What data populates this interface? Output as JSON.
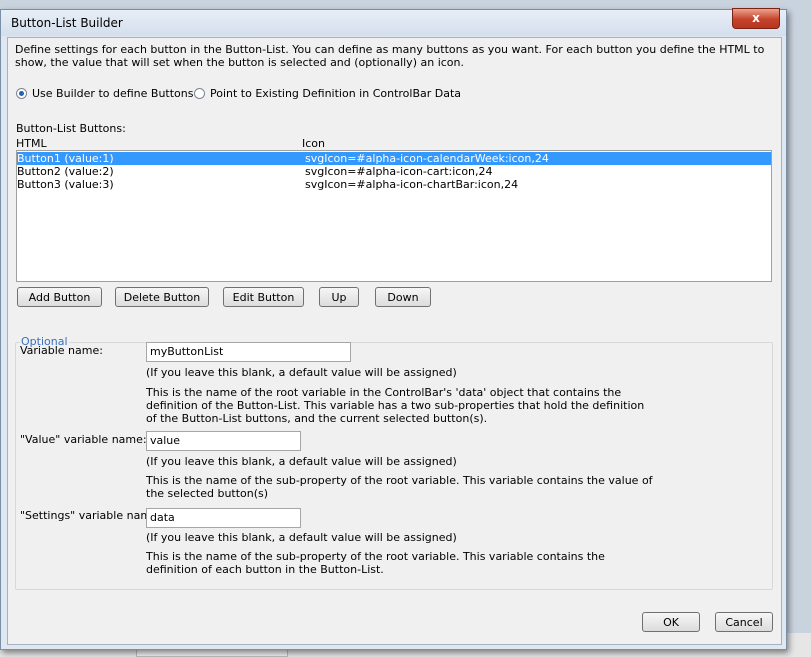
{
  "dialog": {
    "title": "Button-List Builder",
    "close_glyph": "x",
    "description": "Define settings for each button in the Button-List. You can define as many buttons as you want. For each button you define the HTML to show, the value that will set when the button is selected and (optionally) an icon."
  },
  "mode": {
    "option_builder": "Use Builder to define Buttons",
    "option_existing": "Point to Existing Definition in ControlBar Data",
    "selected": "builder"
  },
  "buttons_list": {
    "label": "Button-List Buttons:",
    "col_html": "HTML",
    "col_icon": "Icon",
    "rows": [
      {
        "html": "Button1 (value:1)",
        "icon": "svgIcon=#alpha-icon-calendarWeek:icon,24",
        "selected": true
      },
      {
        "html": "Button2 (value:2)",
        "icon": "svgIcon=#alpha-icon-cart:icon,24",
        "selected": false
      },
      {
        "html": "Button3 (value:3)",
        "icon": "svgIcon=#alpha-icon-chartBar:icon,24",
        "selected": false
      }
    ]
  },
  "toolbar": {
    "add": "Add Button",
    "delete": "Delete Button",
    "edit": "Edit Button",
    "up": "Up",
    "down": "Down"
  },
  "optional": {
    "legend": "Optional",
    "variable_name": {
      "label": "Variable name:",
      "value": "myButtonList",
      "hint": "(If you leave this blank, a default value will be assigned)",
      "help": "This is the name of the root variable in the ControlBar's 'data' object that contains the definition of the Button-List. This variable has a two sub-properties that hold the definition of the Button-List buttons, and the current selected button(s)."
    },
    "value_variable": {
      "label": "\"Value\" variable name:",
      "value": "value",
      "hint": "(If you leave this blank, a default value will be assigned)",
      "help": "This is the name of the sub-property of the root variable. This variable contains the value of the selected button(s)"
    },
    "settings_variable": {
      "label": "\"Settings\" variable name:",
      "value": "data",
      "hint": "(If you leave this blank, a default value will be assigned)",
      "help": "This is the name of the sub-property of the root variable. This variable contains the definition of each button in the Button-List."
    }
  },
  "footer": {
    "ok": "OK",
    "cancel": "Cancel"
  },
  "colors": {
    "selection": "#3399ff",
    "close_button": "#c6422a",
    "legend": "#3a6fc0"
  }
}
